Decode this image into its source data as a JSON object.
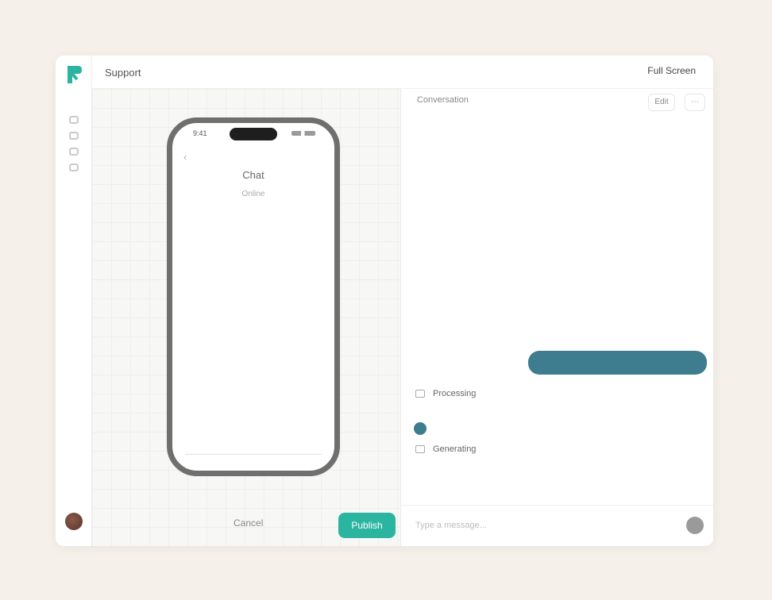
{
  "app": {
    "accent": "#2bb5a0",
    "user_bubble": "#3e7c8f",
    "background": "#f5f0e9"
  },
  "sidebar": {
    "logo": "logo-icon",
    "items": [
      {
        "icon": "home-icon"
      },
      {
        "icon": "layers-icon"
      },
      {
        "icon": "chat-icon"
      },
      {
        "icon": "settings-icon"
      }
    ],
    "avatar": "user-avatar"
  },
  "header": {
    "title": "Support",
    "action": "Full Screen"
  },
  "preview": {
    "status_time": "9:41",
    "back": "‹",
    "screen_title": "Chat",
    "screen_subtitle": "Online",
    "caption": "",
    "secondary_button": "Cancel",
    "primary_button": "Publish"
  },
  "chat": {
    "title": "Conversation",
    "header_buttons": [
      "Edit",
      "⋯"
    ],
    "user_message": "",
    "bot_items": [
      {
        "title": "Processing",
        "subtitle": ""
      },
      {
        "title": "Generating",
        "subtitle": ""
      }
    ],
    "dot_text": "",
    "placeholder_lines": [
      "",
      ""
    ],
    "input_placeholder": "Type a message..."
  }
}
